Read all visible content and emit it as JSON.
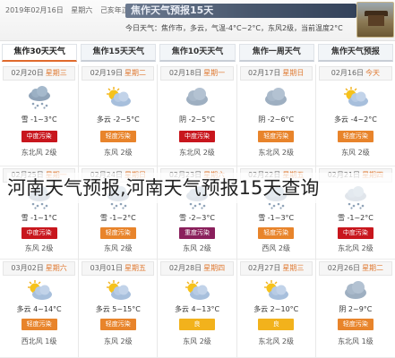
{
  "header": {
    "date_line": [
      "2019年02月16日",
      "星期六",
      "己亥年正月十二"
    ],
    "banner_title": "焦作天气预报15天",
    "summary": "今日天气：焦作市，多云，气温-4°C~2°C，东风2级，当前温度2°C"
  },
  "tabs": [
    {
      "label": "焦作30天天气",
      "active": true
    },
    {
      "label": "焦作15天天气",
      "active": false
    },
    {
      "label": "焦作10天天气",
      "active": false
    },
    {
      "label": "焦作一周天气",
      "active": false
    },
    {
      "label": "焦作天气预报",
      "active": false
    }
  ],
  "days": [
    {
      "date": "02月20日",
      "weekday": "星期三",
      "icon": "snow-icon",
      "cond": "雪 -1~3°C",
      "aqi": "中度污染",
      "aqi_color": "#c8161d",
      "wind": "东北风 2级"
    },
    {
      "date": "02月19日",
      "weekday": "星期二",
      "icon": "sun-cloud-icon",
      "cond": "多云 -2~5°C",
      "aqi": "轻度污染",
      "aqi_color": "#e8842b",
      "wind": "东风 2级"
    },
    {
      "date": "02月18日",
      "weekday": "星期一",
      "icon": "cloud-icon",
      "cond": "阴 -2~5°C",
      "aqi": "中度污染",
      "aqi_color": "#c8161d",
      "wind": "东北风 2级"
    },
    {
      "date": "02月17日",
      "weekday": "星期日",
      "icon": "cloud-icon",
      "cond": "阴 -2~6°C",
      "aqi": "轻度污染",
      "aqi_color": "#e8842b",
      "wind": "东北风 2级"
    },
    {
      "date": "02月16日",
      "weekday": "今天",
      "icon": "sun-cloud-icon",
      "cond": "多云 -4~2°C",
      "aqi": "轻度污染",
      "aqi_color": "#e8842b",
      "wind": "东风 2级"
    },
    {
      "date": "02月25日",
      "weekday": "星期一",
      "icon": "snow-icon",
      "cond": "雪 -1~1°C",
      "aqi": "中度污染",
      "aqi_color": "#c8161d",
      "wind": "东风 2级"
    },
    {
      "date": "02月24日",
      "weekday": "星期日",
      "icon": "snow-icon",
      "cond": "雪 -1~2°C",
      "aqi": "轻度污染",
      "aqi_color": "#e8842b",
      "wind": "东风 2级"
    },
    {
      "date": "02月23日",
      "weekday": "星期六",
      "icon": "snow-icon",
      "cond": "雪 -2~3°C",
      "aqi": "重度污染",
      "aqi_color": "#8a1f5c",
      "wind": "东风 2级"
    },
    {
      "date": "02月22日",
      "weekday": "星期五",
      "icon": "snow-icon",
      "cond": "雪 -1~3°C",
      "aqi": "轻度污染",
      "aqi_color": "#e8842b",
      "wind": "西风 2级"
    },
    {
      "date": "02月21日",
      "weekday": "星期四",
      "icon": "snow-icon",
      "cond": "雪 -1~2°C",
      "aqi": "中度污染",
      "aqi_color": "#c8161d",
      "wind": "东北风 2级"
    },
    {
      "date": "03月02日",
      "weekday": "星期六",
      "icon": "sun-cloud-icon",
      "cond": "多云 4~14°C",
      "aqi": "轻度污染",
      "aqi_color": "#e8842b",
      "wind": "西北风 1级"
    },
    {
      "date": "03月01日",
      "weekday": "星期五",
      "icon": "sun-cloud-icon",
      "cond": "多云 5~15°C",
      "aqi": "轻度污染",
      "aqi_color": "#e8842b",
      "wind": "东风 2级"
    },
    {
      "date": "02月28日",
      "weekday": "星期四",
      "icon": "sun-cloud-icon",
      "cond": "多云 4~13°C",
      "aqi": "良",
      "aqi_color": "#f2b21c",
      "wind": "东风 2级"
    },
    {
      "date": "02月27日",
      "weekday": "星期三",
      "icon": "sun-cloud-icon",
      "cond": "多云 2~10°C",
      "aqi": "良",
      "aqi_color": "#f2b21c",
      "wind": "东北风 2级"
    },
    {
      "date": "02月26日",
      "weekday": "星期二",
      "icon": "cloud-icon",
      "cond": "阴 2~9°C",
      "aqi": "轻度污染",
      "aqi_color": "#e8842b",
      "wind": "东北风 1级"
    }
  ],
  "watermark": "河南天气预报,河南天气预报15天查询"
}
